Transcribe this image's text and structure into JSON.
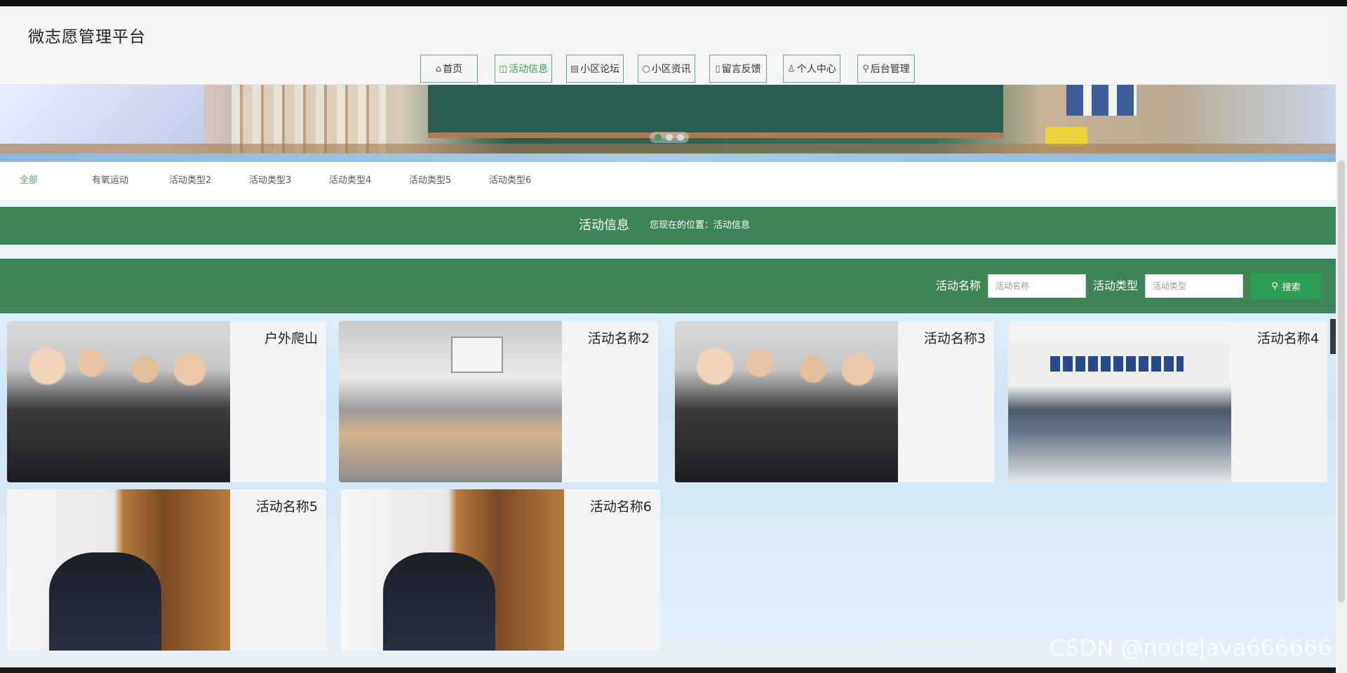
{
  "site_title": "微志愿管理平台",
  "nav": [
    {
      "label": "首页",
      "icon": "home-icon",
      "glyph": "⌂"
    },
    {
      "label": "活动信息",
      "icon": "activity-icon",
      "glyph": "◫"
    },
    {
      "label": "小区论坛",
      "icon": "clipboard-icon",
      "glyph": "▤"
    },
    {
      "label": "小区资讯",
      "icon": "circle-icon",
      "glyph": "○"
    },
    {
      "label": "留言反馈",
      "icon": "note-icon",
      "glyph": "▯"
    },
    {
      "label": "个人中心",
      "icon": "user-icon",
      "glyph": "♙"
    },
    {
      "label": "后台管理",
      "icon": "link-icon",
      "glyph": "⚲"
    }
  ],
  "categories": [
    "全部",
    "有氧运动",
    "活动类型2",
    "活动类型3",
    "活动类型4",
    "活动类型5",
    "活动类型6"
  ],
  "section": {
    "title": "活动信息",
    "breadcrumb": "您现在的位置：活动信息"
  },
  "search": {
    "name_label": "活动名称",
    "name_placeholder": "活动名称",
    "type_label": "活动类型",
    "type_placeholder": "活动类型",
    "button_label": "搜索"
  },
  "activities": [
    {
      "name": "户外爬山"
    },
    {
      "name": "活动名称2"
    },
    {
      "name": "活动名称3"
    },
    {
      "name": "活动名称4"
    },
    {
      "name": "活动名称5"
    },
    {
      "name": "活动名称6"
    }
  ],
  "watermark": "CSDN @nodejava666666",
  "colors": {
    "primary_green": "#3d8456",
    "button_green": "#2f9e52",
    "active_text": "#3a9a58"
  }
}
